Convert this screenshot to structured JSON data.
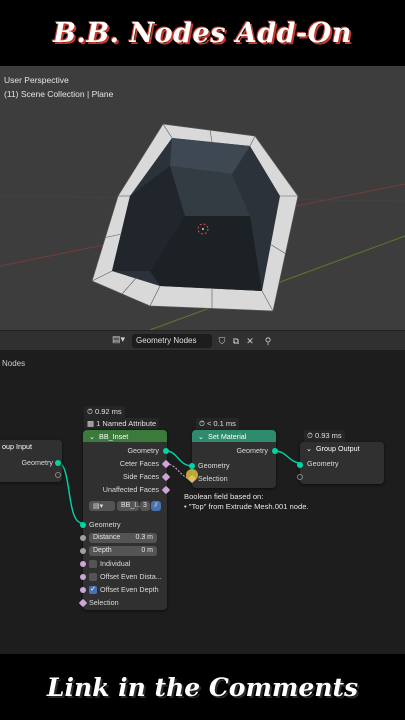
{
  "banner": {
    "title": "B.B. Nodes Add-On",
    "footer": "Link in the Comments",
    "title_shadow_color": "#c0392b"
  },
  "viewport": {
    "perspective": "User Perspective",
    "collection": "(11) Scene Collection | Plane"
  },
  "header": {
    "editor_icon": "node-editor-icon",
    "node_tree": "Geometry Nodes"
  },
  "node_editor": {
    "label": "Nodes"
  },
  "nodes": {
    "group_input": {
      "title": "oup Input",
      "output": "Geometry"
    },
    "bb_inset": {
      "timing": "0.92 ms",
      "attribute": "1 Named Attribute",
      "title": "BB_Inset",
      "header_color": "#3a7a3a",
      "outputs": [
        "Geometry",
        "Ceter Faces",
        "Side Faces",
        "Unaffected Faces"
      ],
      "group_name": "BB_I...",
      "users": "3",
      "input_geometry": "Geometry",
      "distance_label": "Distance",
      "distance_value": "0.3 m",
      "depth_label": "Depth",
      "depth_value": "0 m",
      "individual": "Individual",
      "offset_even_distance": "Offset Even Dista...",
      "offset_even_depth": "Offset Even Depth",
      "selection": "Selection"
    },
    "set_material": {
      "timing": "< 0.1 ms",
      "title": "Set Material",
      "header_color": "#2e8b6e",
      "output": "Geometry",
      "input_geometry": "Geometry",
      "input_selection": "Selection"
    },
    "group_output": {
      "timing": "0.93 ms",
      "title": "Group Output",
      "input": "Geometry"
    }
  },
  "tooltip": {
    "line1": "Boolean field based on:",
    "line2": "• \"Top\" from Extrude Mesh.001 node."
  },
  "colors": {
    "geometry_socket": "#00d6a3",
    "bool_socket": "#cca6d6",
    "node_bg": "#303030",
    "editor_bg": "#1d1d1d",
    "viewport_bg": "#3d3d3d"
  }
}
